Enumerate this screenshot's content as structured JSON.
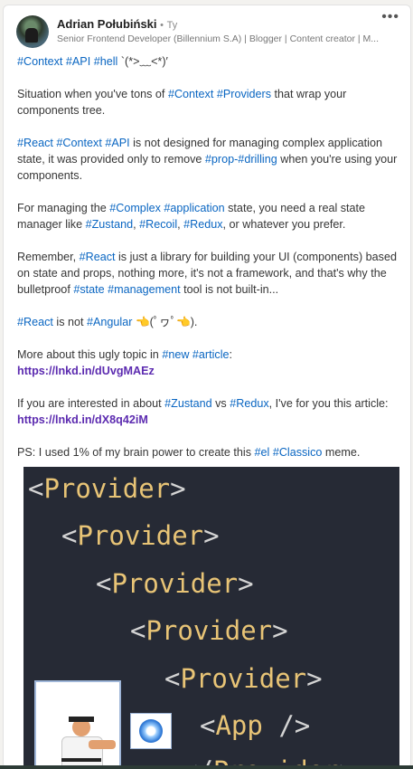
{
  "author": {
    "name": "Adrian Połubiński",
    "separator": "•",
    "age": "Ty",
    "headline": "Senior Frontend Developer (Billennium S.A) | Blogger | Content creator | M..."
  },
  "post": {
    "paragraphs": [
      [
        {
          "t": "tag",
          "v": "#Context"
        },
        {
          "t": "txt",
          "v": " "
        },
        {
          "t": "tag",
          "v": "#API"
        },
        {
          "t": "txt",
          "v": " "
        },
        {
          "t": "tag",
          "v": "#hell"
        },
        {
          "t": "txt",
          "v": " `(*>﹏<*)′"
        }
      ],
      [
        {
          "t": "txt",
          "v": "Situation when you've tons of "
        },
        {
          "t": "tag",
          "v": "#Context"
        },
        {
          "t": "txt",
          "v": " "
        },
        {
          "t": "tag",
          "v": "#Providers"
        },
        {
          "t": "txt",
          "v": " that wrap your components tree."
        }
      ],
      [
        {
          "t": "tag",
          "v": "#React"
        },
        {
          "t": "txt",
          "v": " "
        },
        {
          "t": "tag",
          "v": "#Context"
        },
        {
          "t": "txt",
          "v": " "
        },
        {
          "t": "tag",
          "v": "#API"
        },
        {
          "t": "txt",
          "v": " is not designed for managing complex application state, it was provided only to remove "
        },
        {
          "t": "tag",
          "v": "#prop-#drilling"
        },
        {
          "t": "txt",
          "v": " when you're using your components."
        }
      ],
      [
        {
          "t": "txt",
          "v": "For managing the "
        },
        {
          "t": "tag",
          "v": "#Complex"
        },
        {
          "t": "txt",
          "v": " "
        },
        {
          "t": "tag",
          "v": "#application"
        },
        {
          "t": "txt",
          "v": " state, you need a real state manager like "
        },
        {
          "t": "tag",
          "v": "#Zustand"
        },
        {
          "t": "txt",
          "v": ", "
        },
        {
          "t": "tag",
          "v": "#Recoil"
        },
        {
          "t": "txt",
          "v": ", "
        },
        {
          "t": "tag",
          "v": "#Redux"
        },
        {
          "t": "txt",
          "v": ", or whatever you prefer."
        }
      ],
      [
        {
          "t": "txt",
          "v": "Remember, "
        },
        {
          "t": "tag",
          "v": "#React"
        },
        {
          "t": "txt",
          "v": " is just a library for building your UI (components) based on state and props, nothing more, it's not a framework, and that's why the bulletproof "
        },
        {
          "t": "tag",
          "v": "#state"
        },
        {
          "t": "txt",
          "v": " "
        },
        {
          "t": "tag",
          "v": "#management"
        },
        {
          "t": "txt",
          "v": " tool is not built-in..."
        }
      ],
      [
        {
          "t": "tag",
          "v": "#React"
        },
        {
          "t": "txt",
          "v": " is not "
        },
        {
          "t": "tag",
          "v": "#Angular"
        },
        {
          "t": "txt",
          "v": " "
        },
        {
          "t": "hand",
          "v": "👈"
        },
        {
          "t": "txt",
          "v": "(ﾟヮﾟ"
        },
        {
          "t": "hand",
          "v": "👈"
        },
        {
          "t": "txt",
          "v": ")."
        }
      ],
      [
        {
          "t": "txt",
          "v": "More about this ugly topic in "
        },
        {
          "t": "tag",
          "v": "#new"
        },
        {
          "t": "txt",
          "v": " "
        },
        {
          "t": "tag",
          "v": "#article"
        },
        {
          "t": "txt",
          "v": ":"
        },
        {
          "t": "br"
        },
        {
          "t": "link",
          "v": "https://lnkd.in/dUvgMAEz"
        }
      ],
      [
        {
          "t": "txt",
          "v": "If you are interested in about "
        },
        {
          "t": "tag",
          "v": "#Zustand"
        },
        {
          "t": "txt",
          "v": " vs "
        },
        {
          "t": "tag",
          "v": "#Redux"
        },
        {
          "t": "txt",
          "v": ", I've for you this article:"
        },
        {
          "t": "br"
        },
        {
          "t": "link",
          "v": "https://lnkd.in/dX8q42iM"
        }
      ],
      [
        {
          "t": "txt",
          "v": "PS: I used 1% of my brain power to create this "
        },
        {
          "t": "tag",
          "v": "#el"
        },
        {
          "t": "txt",
          "v": " "
        },
        {
          "t": "tag",
          "v": "#Classico"
        },
        {
          "t": "txt",
          "v": " meme."
        }
      ]
    ]
  },
  "meme": {
    "lines": [
      {
        "open": "<",
        "name": "Provider",
        "close": ">"
      },
      {
        "open": "<",
        "name": "Provider",
        "close": ">"
      },
      {
        "open": "<",
        "name": "Provider",
        "close": ">"
      },
      {
        "open": "<",
        "name": "Provider",
        "close": ">"
      },
      {
        "open": "<",
        "name": "Provider",
        "close": ">"
      },
      {
        "open": "<",
        "name": "App",
        "close": " />"
      },
      {
        "open": "</",
        "name": "Provider",
        "close": ">"
      }
    ]
  },
  "icons": {
    "more": "more-options-icon",
    "hand": "backhand-index-pointing-left-icon",
    "hadouken": "hadouken-energy-icon"
  },
  "colors": {
    "hashtag": "#0a66c2",
    "link": "#5c2bb0",
    "meme_background": "#262a35",
    "tag_name": "#e8c476",
    "tag_bracket": "#d4d4d4"
  }
}
